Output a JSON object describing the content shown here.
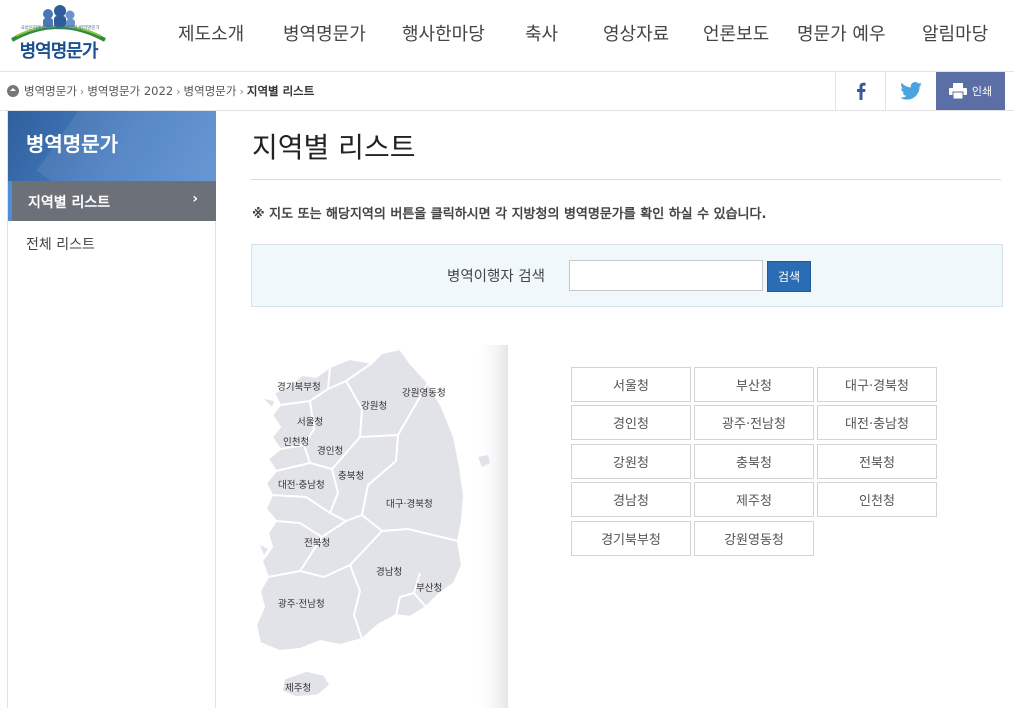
{
  "header": {
    "logo_tag": "국방문화예술진흥재단, 병무청 병역명문가",
    "logo_text": "병역명문가",
    "nav": [
      "제도소개",
      "병역명문가",
      "행사한마당",
      "축사",
      "영상자료",
      "언론보도",
      "명문가 예우",
      "알림마당"
    ]
  },
  "breadcrumb": [
    "병역명문가",
    "병역명문가 2022",
    "병역명문가",
    "지역별 리스트"
  ],
  "share": {
    "print_label": "인쇄"
  },
  "sidebar": {
    "title": "병역명문가",
    "items": [
      {
        "label": "지역별 리스트",
        "active": true
      },
      {
        "label": "전체 리스트",
        "active": false
      }
    ]
  },
  "main": {
    "title": "지역별 리스트",
    "notice": "※ 지도 또는 해당지역의 버튼을 클릭하시면 각 지방청의 병역명문가를 확인 하실 수 있습니다.",
    "search": {
      "label": "병역이행자 검색",
      "value": "",
      "placeholder": "",
      "button": "검색"
    }
  },
  "map_labels": [
    "경기북부청",
    "강원영동청",
    "강원청",
    "서울청",
    "인천청",
    "경인청",
    "충북청",
    "대전·충남청",
    "대구·경북청",
    "전북청",
    "경남청",
    "부산청",
    "광주·전남청",
    "제주청"
  ],
  "regions": [
    "서울청",
    "부산청",
    "대구·경북청",
    "경인청",
    "광주·전남청",
    "대전·충남청",
    "강원청",
    "충북청",
    "전북청",
    "경남청",
    "제주청",
    "인천청",
    "경기북부청",
    "강원영동청"
  ],
  "colors": {
    "accent": "#2b6db5",
    "sidebar_active": "#6b7079",
    "print": "#5b6fa6",
    "map_fill": "#e2e3e8"
  }
}
